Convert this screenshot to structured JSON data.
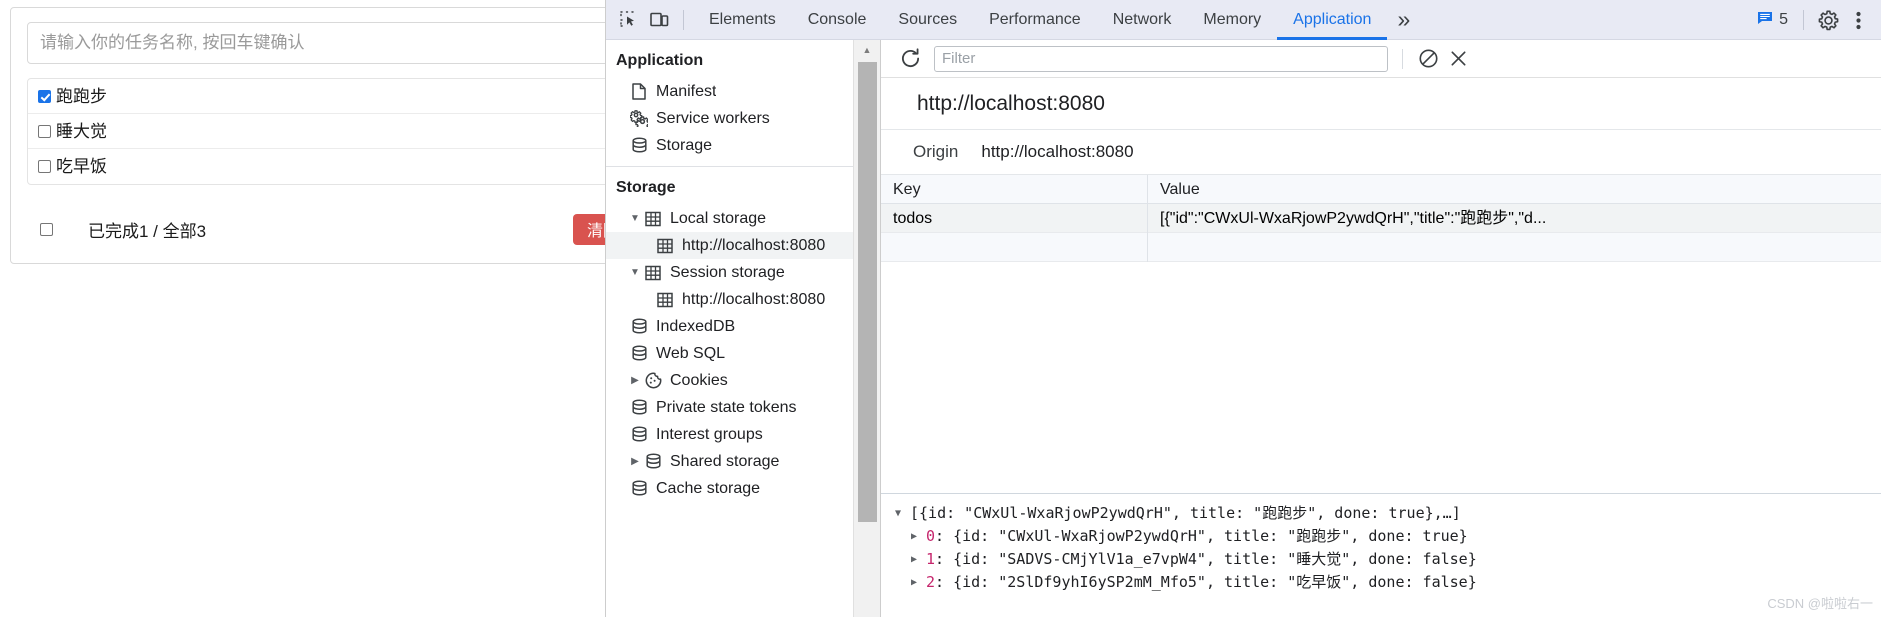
{
  "webpage": {
    "input_placeholder": "请输入你的任务名称, 按回车键确认",
    "input_value": "",
    "todos": [
      {
        "label": "跑跑步",
        "done": true
      },
      {
        "label": "睡大觉",
        "done": false
      },
      {
        "label": "吃早饭",
        "done": false
      }
    ],
    "footer": {
      "toggle_all_checked": false,
      "count_text": "已完成1 / 全部3",
      "clear_button": "清除已完成"
    }
  },
  "devtools": {
    "toolbar": {
      "inspect_icon": "inspect-element-icon",
      "device_icon": "device-toolbar-icon",
      "tabs": [
        {
          "label": "Elements",
          "active": false
        },
        {
          "label": "Console",
          "active": false
        },
        {
          "label": "Sources",
          "active": false
        },
        {
          "label": "Performance",
          "active": false
        },
        {
          "label": "Network",
          "active": false
        },
        {
          "label": "Memory",
          "active": false
        },
        {
          "label": "Application",
          "active": true
        }
      ],
      "more_tabs": "»",
      "messages_count": "5",
      "settings_icon": "gear-icon",
      "menu_icon": "kebab-menu-icon"
    },
    "sidebar": {
      "application": {
        "title": "Application",
        "items": [
          {
            "label": "Manifest",
            "icon": "document-icon",
            "arrow": "",
            "indent": 1,
            "selected": false
          },
          {
            "label": "Service workers",
            "icon": "gears-icon",
            "arrow": "",
            "indent": 1,
            "selected": false
          },
          {
            "label": "Storage",
            "icon": "database-icon",
            "arrow": "",
            "indent": 1,
            "selected": false
          }
        ]
      },
      "storage": {
        "title": "Storage",
        "items": [
          {
            "label": "Local storage",
            "icon": "table-icon",
            "arrow": "▼",
            "indent": 1,
            "selected": false
          },
          {
            "label": "http://localhost:8080",
            "icon": "table-icon",
            "arrow": "",
            "indent": 2,
            "selected": true
          },
          {
            "label": "Session storage",
            "icon": "table-icon",
            "arrow": "▼",
            "indent": 1,
            "selected": false
          },
          {
            "label": "http://localhost:8080",
            "icon": "table-icon",
            "arrow": "",
            "indent": 2,
            "selected": false
          },
          {
            "label": "IndexedDB",
            "icon": "database-icon",
            "arrow": "",
            "indent": 1,
            "selected": false
          },
          {
            "label": "Web SQL",
            "icon": "database-icon",
            "arrow": "",
            "indent": 1,
            "selected": false
          },
          {
            "label": "Cookies",
            "icon": "cookie-icon",
            "arrow": "▶",
            "indent": 1,
            "selected": false
          },
          {
            "label": "Private state tokens",
            "icon": "database-icon",
            "arrow": "",
            "indent": 1,
            "selected": false
          },
          {
            "label": "Interest groups",
            "icon": "database-icon",
            "arrow": "",
            "indent": 1,
            "selected": false
          },
          {
            "label": "Shared storage",
            "icon": "database-icon",
            "arrow": "▶",
            "indent": 1,
            "selected": false
          },
          {
            "label": "Cache storage",
            "icon": "database-icon",
            "arrow": "",
            "indent": 1,
            "selected": false
          }
        ]
      }
    },
    "main": {
      "refresh_icon": "refresh-icon",
      "filter_placeholder": "Filter",
      "filter_value": "",
      "clear_icon": "clear-all-icon",
      "delete_icon": "delete-selected-icon",
      "origin_url": "http://localhost:8080",
      "origin_label": "Origin",
      "origin_value": "http://localhost:8080",
      "table": {
        "columns": [
          "Key",
          "Value"
        ],
        "rows": [
          {
            "key": "todos",
            "value": "[{\"id\":\"CWxUl-WxaRjowP2ywdQrH\",\"title\":\"跑跑步\",\"d..."
          }
        ]
      },
      "preview": {
        "root": "[{id: \"CWxUl-WxaRjowP2ywdQrH\", title: \"跑跑步\", done: true},…]",
        "root_arrow": "▼",
        "children": [
          {
            "index": "0",
            "arrow": "▶",
            "text": ": {id: \"CWxUl-WxaRjowP2ywdQrH\", title: \"跑跑步\", done: true}"
          },
          {
            "index": "1",
            "arrow": "▶",
            "text": ": {id: \"SADVS-CMjYlV1a_e7vpW4\", title: \"睡大觉\", done: false}"
          },
          {
            "index": "2",
            "arrow": "▶",
            "text": ": {id: \"2SlDf9yhI6ySP2mM_Mfo5\", title: \"吃早饭\", done: false}"
          }
        ]
      }
    }
  },
  "watermark": "CSDN @啦啦右一",
  "colors": {
    "accent": "#1a73e8",
    "danger": "#d9534f",
    "tabbar_bg": "#e8eaf4"
  }
}
